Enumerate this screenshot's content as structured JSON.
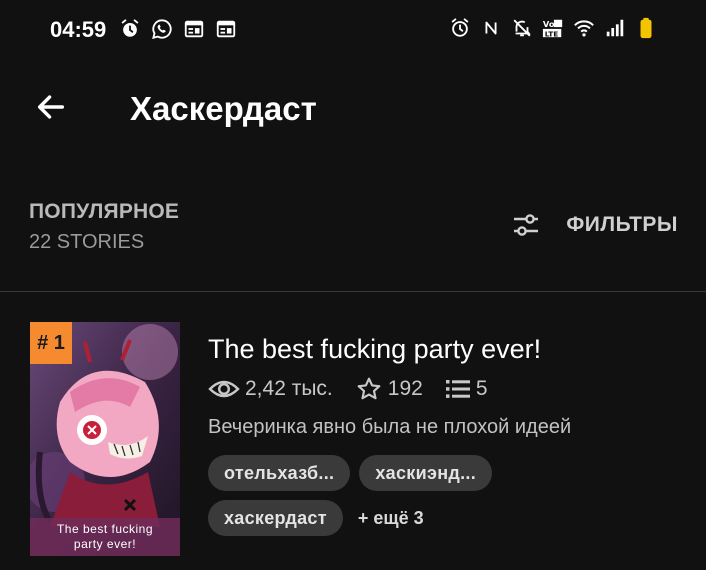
{
  "status_bar": {
    "time": "04:59",
    "left_icons": [
      "alarm-icon",
      "whatsapp-icon",
      "notification-window-icon",
      "notification-window-icon"
    ],
    "right_icons": [
      "alarm-icon",
      "nfc-icon",
      "mute-icon",
      "volte-icon",
      "wifi-icon",
      "signal-icon",
      "battery-icon"
    ],
    "volte_text": "VoLTE",
    "battery_color": "#f5c400"
  },
  "header": {
    "title": "Хаскердаст"
  },
  "sort": {
    "label": "ПОПУЛЯРНОЕ",
    "count": "22 STORIES",
    "filters_label": "ФИЛЬТРЫ"
  },
  "story": {
    "rank": "# 1",
    "title": "The best fucking party ever!",
    "cover_caption_line1": "The best fucking",
    "cover_caption_line2": "party ever!",
    "reads": "2,42 тыс.",
    "votes": "192",
    "parts": "5",
    "description": "Вечеринка явно была не плохой идеей",
    "tags": [
      "отельхазб...",
      "хаскиэнд...",
      "хаскердаст"
    ],
    "more_tags": "+ ещё 3"
  },
  "colors": {
    "background": "#111111",
    "rank_badge": "#f58a2e",
    "tag_bg": "#3a3a3a"
  }
}
